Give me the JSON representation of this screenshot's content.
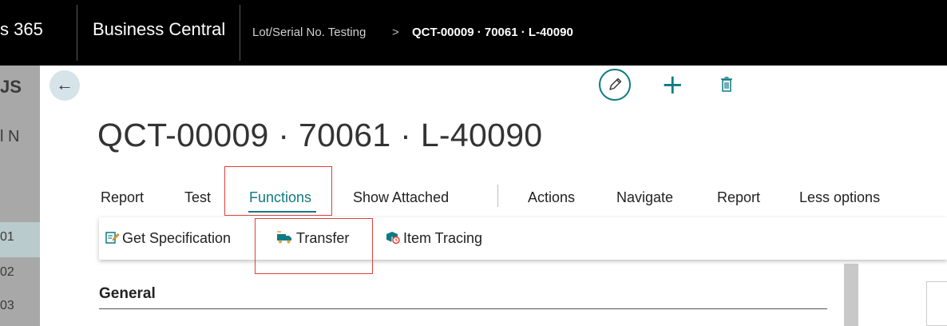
{
  "topbar": {
    "app_partial": "s 365",
    "product": "Business Central",
    "breadcrumb_parent": "Lot/Serial No. Testing",
    "breadcrumb_sep": ">",
    "breadcrumb_current": "QCT-00009 · 70061 · L-40090"
  },
  "background_list": {
    "heading_partial": "JS",
    "col_partial": "l N",
    "rows": [
      "01",
      "02",
      "03"
    ]
  },
  "header_actions": {
    "back_icon": "arrow-left-icon",
    "edit_icon": "pencil-icon",
    "new_icon": "plus-icon",
    "delete_icon": "trash-icon"
  },
  "page": {
    "title": "QCT-00009 · 70061 · L-40090"
  },
  "tabs": {
    "report": "Report",
    "test": "Test",
    "functions": "Functions",
    "show_attached": "Show Attached",
    "actions": "Actions",
    "navigate": "Navigate",
    "report2": "Report",
    "less_options": "Less options"
  },
  "functions_menu": {
    "get_specification": "Get Specification",
    "transfer": "Transfer",
    "item_tracing": "Item Tracing"
  },
  "sections": {
    "general": "General"
  },
  "colors": {
    "accent": "#0f7a82",
    "topbar": "#000000",
    "highlight_box": "#e2403a"
  }
}
